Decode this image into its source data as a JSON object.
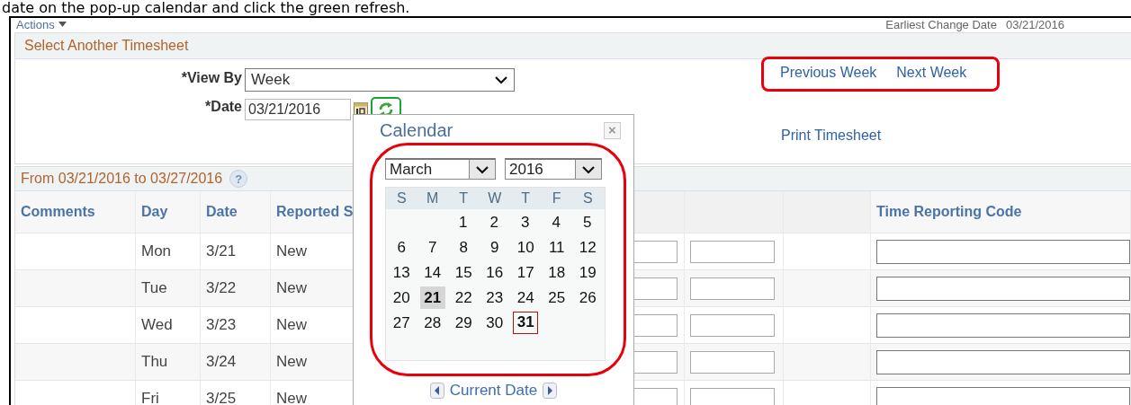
{
  "caption": "date on the pop-up calendar and click the green refresh.",
  "actions": {
    "label": "Actions",
    "earliest_change_label": "Earliest Change Date",
    "earliest_change_date": "03/21/2016"
  },
  "select_panel": {
    "title": "Select Another Timesheet",
    "view_by_label": "*View By",
    "view_by": "Week",
    "date_label": "*Date",
    "date": "03/21/2016",
    "links": [
      "Previous Week",
      "Next Week"
    ],
    "print_link": "Print Timesheet"
  },
  "annotations": [
    {
      "kind": "refresh",
      "color": "#1aa33a"
    },
    {
      "kind": "week-links",
      "color": "#e8000b"
    },
    {
      "kind": "calendar",
      "color": "#e8000b"
    }
  ],
  "period": {
    "title": "From 03/21/2016 to 03/27/2016",
    "help": "?"
  },
  "table": {
    "columns": [
      {
        "kind": "blank",
        "label": "Comments"
      },
      {
        "kind": "text",
        "label": "Day"
      },
      {
        "kind": "text",
        "label": "Date"
      },
      {
        "kind": "text",
        "label": "Reported S"
      },
      {
        "kind": "input"
      },
      {
        "kind": "input"
      },
      {
        "kind": "blank"
      },
      {
        "kind": "input",
        "label": "Time Reporting Code"
      }
    ],
    "rows": [
      {
        "cells": [
          "",
          "Mon",
          "3/21",
          "New"
        ]
      },
      {
        "cells": [
          "",
          "Tue",
          "3/22",
          "New"
        ]
      },
      {
        "cells": [
          "",
          "Wed",
          "3/23",
          "New"
        ]
      },
      {
        "cells": [
          "",
          "Thu",
          "3/24",
          "New"
        ]
      },
      {
        "cells": [
          "",
          "Fri",
          "3/25",
          "New"
        ]
      }
    ]
  },
  "calendar": {
    "title": "Calendar",
    "close": "×",
    "month": "March",
    "year": "2016",
    "footer": "Current Date",
    "weekdays": [
      "S",
      "M",
      "T",
      "W",
      "T",
      "F",
      "S"
    ],
    "weeks": [
      {
        "days": [
          {
            "day": "1",
            "selected": false,
            "today": false
          },
          {
            "day": "2",
            "selected": false,
            "today": false
          },
          {
            "day": "3",
            "selected": false,
            "today": false
          },
          {
            "day": "4",
            "selected": false,
            "today": false
          },
          {
            "day": "5",
            "selected": false,
            "today": false
          }
        ]
      },
      {
        "days": [
          {
            "day": "6",
            "selected": false,
            "today": false
          },
          {
            "day": "7",
            "selected": false,
            "today": false
          },
          {
            "day": "8",
            "selected": false,
            "today": false
          },
          {
            "day": "9",
            "selected": false,
            "today": false
          },
          {
            "day": "10",
            "selected": false,
            "today": false
          },
          {
            "day": "11",
            "selected": false,
            "today": false
          },
          {
            "day": "12",
            "selected": false,
            "today": false
          }
        ]
      },
      {
        "days": [
          {
            "day": "13",
            "selected": false,
            "today": false
          },
          {
            "day": "14",
            "selected": false,
            "today": false
          },
          {
            "day": "15",
            "selected": false,
            "today": false
          },
          {
            "day": "16",
            "selected": false,
            "today": false
          },
          {
            "day": "17",
            "selected": false,
            "today": false
          },
          {
            "day": "18",
            "selected": false,
            "today": false
          },
          {
            "day": "19",
            "selected": false,
            "today": false
          }
        ]
      },
      {
        "days": [
          {
            "day": "20",
            "selected": false,
            "today": false
          },
          {
            "day": "21",
            "selected": true,
            "today": false
          },
          {
            "day": "22",
            "selected": false,
            "today": false
          },
          {
            "day": "23",
            "selected": false,
            "today": false
          },
          {
            "day": "24",
            "selected": false,
            "today": false
          },
          {
            "day": "25",
            "selected": false,
            "today": false
          },
          {
            "day": "26",
            "selected": false,
            "today": false
          }
        ]
      },
      {
        "days": [
          {
            "day": "27",
            "selected": false,
            "today": false
          },
          {
            "day": "28",
            "selected": false,
            "today": false
          },
          {
            "day": "29",
            "selected": false,
            "today": false
          },
          {
            "day": "30",
            "selected": false,
            "today": false
          },
          {
            "day": "31",
            "selected": false,
            "today": true
          }
        ]
      }
    ]
  }
}
